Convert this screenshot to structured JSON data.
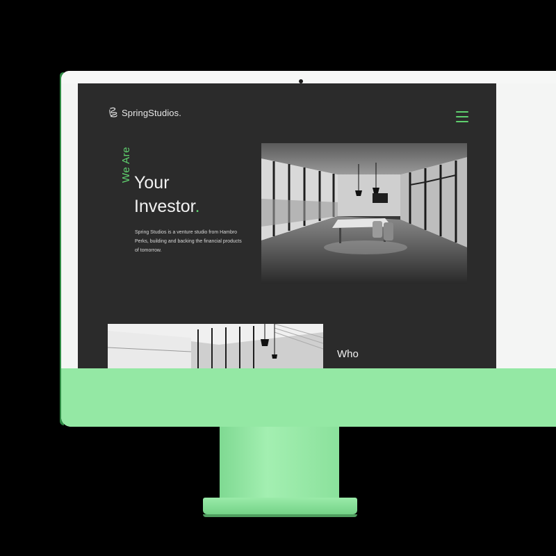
{
  "brand": {
    "name": "SpringStudios.",
    "accent_color": "#5fd06e",
    "monitor_color": "#94e8a4"
  },
  "nav": {
    "menu_icon": "hamburger-menu-icon"
  },
  "hero": {
    "vertical_label": "We Are",
    "headline_line1": "Your",
    "headline_line2": "Investor",
    "headline_dot": ".",
    "intro_line1": "Spring Studios is a venture studio from Hambro",
    "intro_line2": "Perks, building and backing the financial products",
    "intro_line3": "of tomorrow."
  },
  "section": {
    "heading": "Who"
  }
}
